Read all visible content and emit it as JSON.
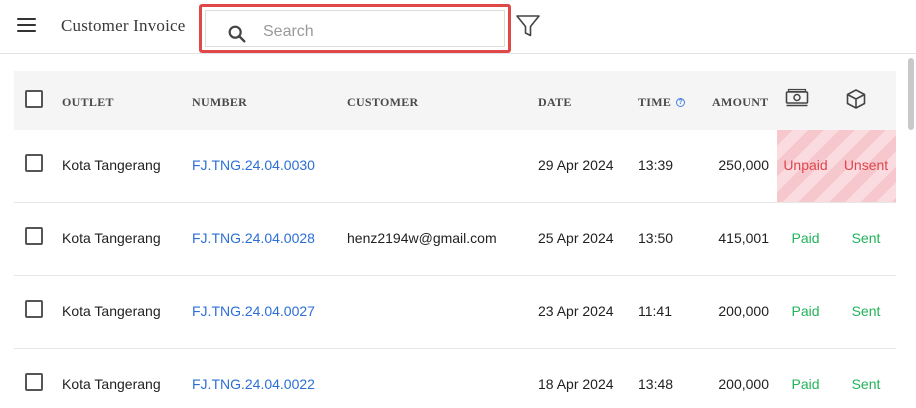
{
  "header": {
    "title": "Customer Invoice",
    "search": {
      "placeholder": "Search",
      "value": ""
    }
  },
  "table": {
    "columns": {
      "outlet": "OUTLET",
      "number": "NUMBER",
      "customer": "CUSTOMER",
      "date": "DATE",
      "time": "TIME",
      "amount": "AMOUNT"
    },
    "rows": [
      {
        "outlet": "Kota Tangerang",
        "number": "FJ.TNG.24.04.0030",
        "customer": "",
        "date": "29 Apr 2024",
        "time": "13:39",
        "amount": "250,000",
        "payment": "Unpaid",
        "shipping": "Unsent"
      },
      {
        "outlet": "Kota Tangerang",
        "number": "FJ.TNG.24.04.0028",
        "customer": "henz2194w@gmail.com",
        "date": "25 Apr 2024",
        "time": "13:50",
        "amount": "415,001",
        "payment": "Paid",
        "shipping": "Sent"
      },
      {
        "outlet": "Kota Tangerang",
        "number": "FJ.TNG.24.04.0027",
        "customer": "",
        "date": "23 Apr 2024",
        "time": "11:41",
        "amount": "200,000",
        "payment": "Paid",
        "shipping": "Sent"
      },
      {
        "outlet": "Kota Tangerang",
        "number": "FJ.TNG.24.04.0022",
        "customer": "",
        "date": "18 Apr 2024",
        "time": "13:48",
        "amount": "200,000",
        "payment": "Paid",
        "shipping": "Sent"
      }
    ]
  },
  "colors": {
    "link": "#2b6fd6",
    "paid": "#22b35a",
    "unpaid": "#e0444c",
    "search_highlight": "#e04848"
  },
  "icons": {
    "menu": "hamburger-menu-icon",
    "search": "search-icon",
    "filter": "filter-icon",
    "payment_column": "money-icon",
    "shipping_column": "package-icon",
    "time_help": "help-circle-icon"
  }
}
